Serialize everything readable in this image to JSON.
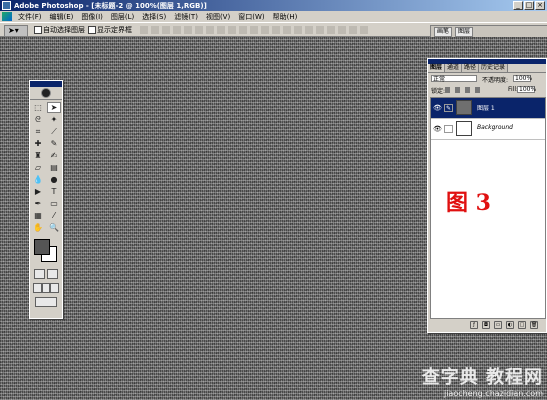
{
  "window": {
    "title": "Adobe Photoshop - [未标题-2 @ 100%(图层 1,RGB)]",
    "buttons": [
      "_",
      "□",
      "×"
    ]
  },
  "menu": [
    "文件(F)",
    "编辑(E)",
    "图像(I)",
    "图层(L)",
    "选择(S)",
    "滤镜(T)",
    "视图(V)",
    "窗口(W)",
    "帮助(H)"
  ],
  "options": {
    "auto_select_label": "自动选择图层",
    "show_bounds_label": "显示定界框"
  },
  "palette_well": {
    "tabs": [
      "画笔",
      "图层"
    ]
  },
  "layers_panel": {
    "tabs": [
      "图层",
      "通道",
      "路径",
      "历史记录"
    ],
    "blend_mode": "正常",
    "opacity_label": "不透明度:",
    "opacity_value": "100%",
    "lock_label": "锁定:",
    "fill_label": "Fill:",
    "fill_value": "100%",
    "layers": [
      {
        "name": "图层 1",
        "selected": true
      },
      {
        "name": "Background",
        "selected": false
      }
    ]
  },
  "annotation": "图 3",
  "watermark": {
    "main": "查字典 教程网",
    "url": "jiaocheng.chazidian.com"
  },
  "colors": {
    "foreground": "#555555",
    "background": "#ffffff",
    "annotation": "#e01010"
  }
}
